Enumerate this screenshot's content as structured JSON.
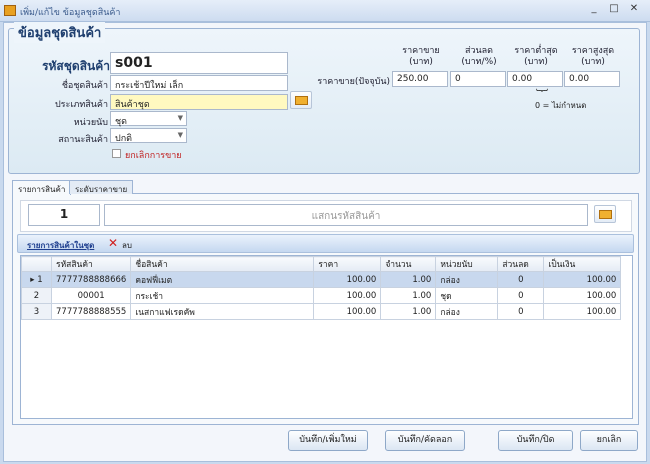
{
  "window": {
    "title": "เพิ่ม/แก้ไข ข้อมูลชุดสินค้า",
    "minimize": "_",
    "maximize": "□",
    "close": "✕"
  },
  "group": {
    "title": "ข้อมูลชุดสินค้า"
  },
  "form": {
    "code_label": "รหัสชุดสินค้า",
    "code_value": "s001",
    "name_label": "ชื่อชุดสินค้า",
    "name_value": "กระเช้าปีใหม่ เล็ก",
    "type_label": "ประเภทสินค้า",
    "type_value": "สินค้าชุด",
    "unit_label": "หน่วยนับ",
    "unit_value": "ชุด",
    "status_label": "สถานะสินค้า",
    "status_value": "ปกติ",
    "cancel_sale_label": "ยกเลิกการขาย"
  },
  "price": {
    "headers": [
      {
        "t": "ราคาขาย",
        "u": "(บาท)"
      },
      {
        "t": "ส่วนลด",
        "u": "(บาท/%)"
      },
      {
        "t": "ราคาต่ำสุด",
        "u": "(บาท)"
      },
      {
        "t": "ราคาสูงสุด",
        "u": "(บาท)"
      }
    ],
    "row_label": "ราคาขาย(ปัจจุบัน)",
    "values": [
      "250.00",
      "0",
      "0.00",
      "0.00"
    ],
    "note": "0 = ไม่กำหนด"
  },
  "tabs": [
    "รายการสินค้า",
    "ระดับราคาขาย"
  ],
  "scan": {
    "qty": "1",
    "placeholder": "แสกนรหัสสินค้า"
  },
  "toolbar": {
    "title": "รายการสินค้าในชุด",
    "delete": "ลบ"
  },
  "grid": {
    "columns": [
      "รหัสสินค้า",
      "ชื่อสินค้า",
      "ราคา",
      "จำนวน",
      "หน่วยนับ",
      "ส่วนลด",
      "เป็นเงิน"
    ],
    "rows": [
      {
        "n": "1",
        "code": "7777788888666",
        "name": "คอฟฟี่เมต",
        "price": "100.00",
        "qty": "1.00",
        "unit": "กล่อง",
        "disc": "0",
        "total": "100.00"
      },
      {
        "n": "2",
        "code": "00001",
        "name": "กระเช้า",
        "price": "100.00",
        "qty": "1.00",
        "unit": "ชุด",
        "disc": "0",
        "total": "100.00"
      },
      {
        "n": "3",
        "code": "7777788888555",
        "name": "เนสกาแฟเรดคัพ",
        "price": "100.00",
        "qty": "1.00",
        "unit": "กล่อง",
        "disc": "0",
        "total": "100.00"
      }
    ]
  },
  "buttons": {
    "save_new": "บันทึก/เพิ่มใหม่",
    "save_copy": "บันทึก/คัดลอก",
    "save_close": "บันทึก/ปิด",
    "cancel": "ยกเลิก"
  }
}
